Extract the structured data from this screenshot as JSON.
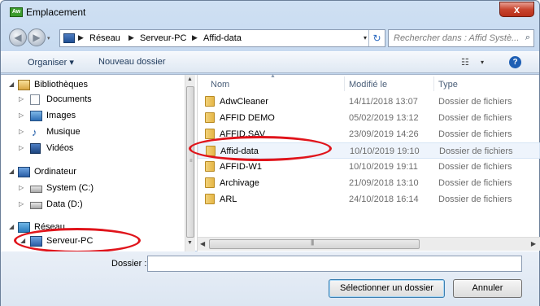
{
  "window": {
    "app_icon_text": "Aw",
    "title": "Emplacement",
    "close_label": "x"
  },
  "nav": {
    "back_arrow": "◀",
    "forward_arrow": "▶",
    "breadcrumbs": [
      "Réseau",
      "Serveur-PC",
      "Affid-data"
    ],
    "separator": "▶",
    "dropdown_arrow": "▾",
    "refresh_glyph": "↻",
    "search_placeholder": "Rechercher dans : Affid Systè...",
    "search_glyph": "⌕"
  },
  "toolbar": {
    "organize_label": "Organiser ▾",
    "new_folder_label": "Nouveau dossier",
    "view_glyph": "☷",
    "view_drop": "▾",
    "help_label": "?"
  },
  "tree": {
    "items": [
      {
        "label": "Bibliothèques",
        "arrow": "◢",
        "icon": "library-icon"
      },
      {
        "label": "Documents",
        "arrow": "▷",
        "icon": "documents-icon"
      },
      {
        "label": "Images",
        "arrow": "▷",
        "icon": "images-icon"
      },
      {
        "label": "Musique",
        "arrow": "▷",
        "icon": "music-icon",
        "glyph": "♪"
      },
      {
        "label": "Vidéos",
        "arrow": "▷",
        "icon": "videos-icon"
      },
      {
        "label": "Ordinateur",
        "arrow": "◢",
        "icon": "computer-icon"
      },
      {
        "label": "System (C:)",
        "arrow": "▷",
        "icon": "drive-icon"
      },
      {
        "label": "Data (D:)",
        "arrow": "▷",
        "icon": "drive-icon"
      },
      {
        "label": "Réseau",
        "arrow": "◢",
        "icon": "network-icon"
      },
      {
        "label": "Serveur-PC",
        "arrow": "◢",
        "icon": "server-pc-icon"
      }
    ]
  },
  "files": {
    "columns": {
      "name": "Nom",
      "modified": "Modifié le",
      "type": "Type"
    },
    "rows": [
      {
        "name": "AdwCleaner",
        "modified": "14/11/2018 13:07",
        "type": "Dossier de fichiers"
      },
      {
        "name": "AFFID DEMO",
        "modified": "05/02/2019 13:12",
        "type": "Dossier de fichiers"
      },
      {
        "name": "AFFID.SAV",
        "modified": "23/09/2019 14:26",
        "type": "Dossier de fichiers"
      },
      {
        "name": "Affid-data",
        "modified": "10/10/2019 19:10",
        "type": "Dossier de fichiers"
      },
      {
        "name": "AFFID-W1",
        "modified": "10/10/2019 19:11",
        "type": "Dossier de fichiers"
      },
      {
        "name": "Archivage",
        "modified": "21/09/2018 13:10",
        "type": "Dossier de fichiers"
      },
      {
        "name": "ARL",
        "modified": "24/10/2018 16:14",
        "type": "Dossier de fichiers"
      }
    ],
    "scroll_grip": "|||"
  },
  "footer": {
    "folder_label": "Dossier :",
    "folder_value": "",
    "select_button": "Sélectionner un dossier",
    "cancel_button": "Annuler"
  },
  "colors": {
    "highlight_ellipse": "#e0141b",
    "selected_row": "#eef4fc",
    "close_button": "#c8452f"
  }
}
